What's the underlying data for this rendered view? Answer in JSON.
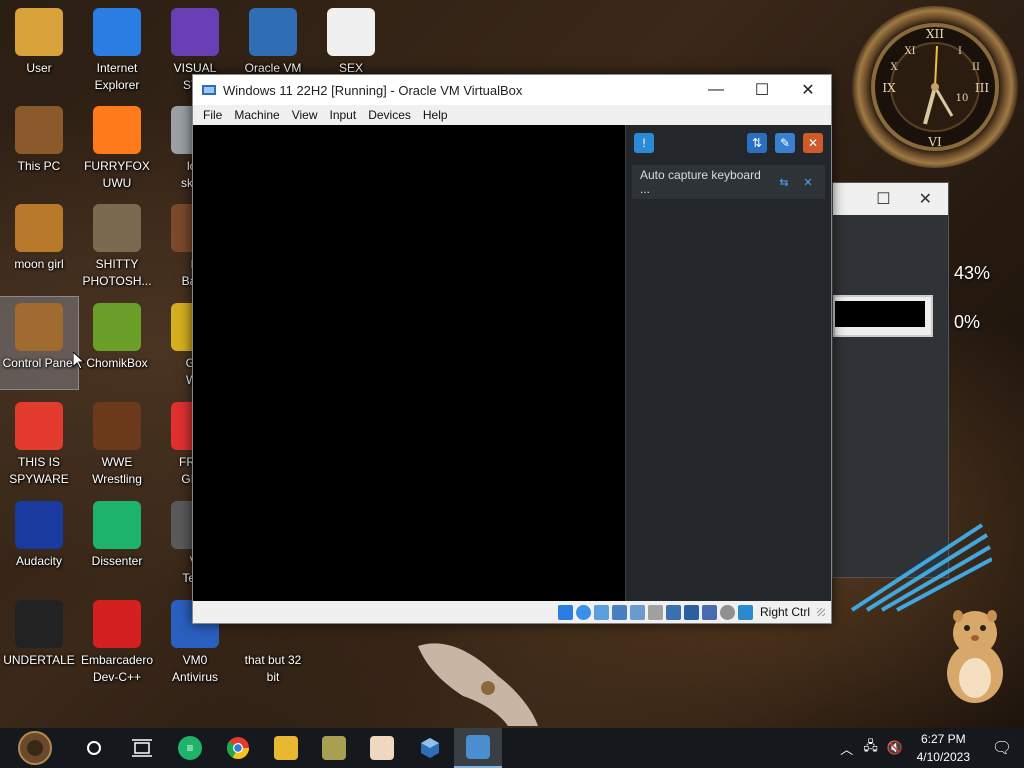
{
  "desktop": {
    "icons": [
      {
        "label": "User",
        "icon": "user-avatar-icon",
        "color": "#d9a23a"
      },
      {
        "label": "Internet\nExplorer",
        "icon": "internet-explorer-icon",
        "color": "#2a7de1"
      },
      {
        "label": "VISUAL\nSTU",
        "icon": "visual-studio-icon",
        "color": "#6a3fb5"
      },
      {
        "label": "Oracle VM",
        "icon": "virtualbox-icon",
        "color": "#2f6db5"
      },
      {
        "label": "SEX",
        "icon": "hxd-icon",
        "color": "#f0f0f0"
      },
      {
        "label": "This PC",
        "icon": "computer-icon",
        "color": "#8a5a2a"
      },
      {
        "label": "FURRYFOX\nUWU",
        "icon": "firefox-icon",
        "color": "#ff7a1a"
      },
      {
        "label": "loo\nskidd",
        "icon": "trash-icon",
        "color": "#9aa0a6"
      },
      {
        "label": "moon girl",
        "icon": "moon-girl-icon",
        "color": "#b87a2a"
      },
      {
        "label": "SHITTY\nPHOTOSH...",
        "icon": "gimp-icon",
        "color": "#7a6a50"
      },
      {
        "label": "N\nBack",
        "icon": "backup-icon",
        "color": "#7a4a2a"
      },
      {
        "label": "Control Panel",
        "icon": "control-panel-icon",
        "color": "#a06a30"
      },
      {
        "label": "ChomikBox",
        "icon": "chomikbox-icon",
        "color": "#6aa02a"
      },
      {
        "label": "GO\nWh",
        "icon": "folder-icon",
        "color": "#d4b020"
      },
      {
        "label": "THIS IS\nSPYWARE",
        "icon": "chrome-icon",
        "color": "#e33b2e"
      },
      {
        "label": "WWE\nWrestling",
        "icon": "wwe-icon",
        "color": "#6a3a1a"
      },
      {
        "label": "FREE\nGIFT",
        "icon": "gift-icon",
        "color": "#e03030"
      },
      {
        "label": "Audacity",
        "icon": "audacity-icon",
        "color": "#1a3aa0"
      },
      {
        "label": "Dissenter",
        "icon": "dissenter-icon",
        "color": "#1db36a"
      },
      {
        "label": "Vi\nTech",
        "icon": "vi-tech-icon",
        "color": "#5a5a5a"
      },
      {
        "label": "UNDERTALE",
        "icon": "unity-icon",
        "color": "#222222"
      },
      {
        "label": "Embarcadero\nDev-C++",
        "icon": "devcpp-icon",
        "color": "#d42020"
      },
      {
        "label": "VM0\nAntivirus",
        "icon": "shield-icon",
        "color": "#2a60c0"
      },
      {
        "label": "that but 32\nbit",
        "icon": "blank-icon",
        "color": "transparent"
      }
    ]
  },
  "vbox": {
    "title": "Windows 11 22H2 [Running] - Oracle VM VirtualBox",
    "menu": [
      "File",
      "Machine",
      "View",
      "Input",
      "Devices",
      "Help"
    ],
    "notice": "Auto capture keyboard ...",
    "host_key": "Right Ctrl"
  },
  "gadget": {
    "pct1": "43%",
    "pct2": "0%"
  },
  "taskbar": {
    "time": "6:27 PM",
    "date": "4/10/2023"
  },
  "colors": {
    "accent": "#2b8ad6",
    "taskbar": "#15191d"
  }
}
